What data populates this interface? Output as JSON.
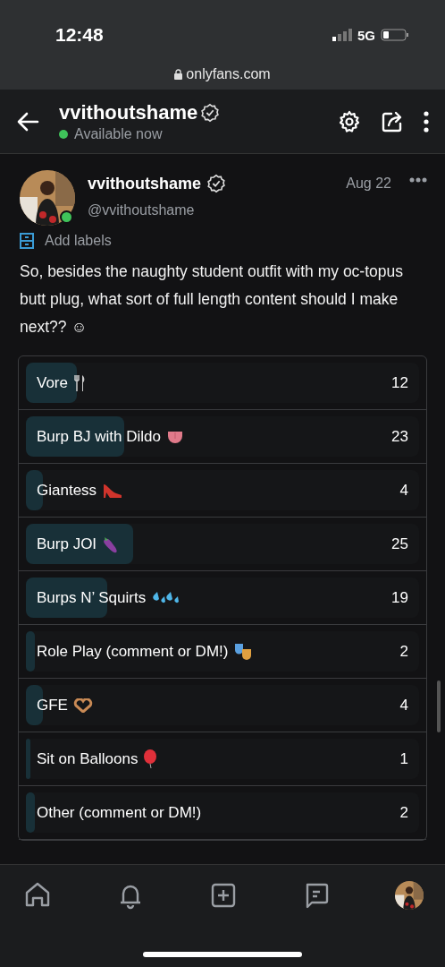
{
  "status_bar": {
    "time": "12:48",
    "network": "5G"
  },
  "browser": {
    "url": "onlyfans.com"
  },
  "header": {
    "title": "vvithoutshame",
    "status": "Available now",
    "online": true
  },
  "post": {
    "author": "vvithoutshame",
    "handle": "@vvithoutshame",
    "date": "Aug 22",
    "online": true,
    "add_labels": "Add labels",
    "text": "So, besides the naughty student outfit with my oc-topus butt plug, what sort of full length content should I make next?? ☺"
  },
  "poll": {
    "options": [
      {
        "label": "Vore",
        "votes": "12",
        "level": 0.13
      },
      {
        "label": "Burp BJ with Dildo",
        "votes": "23",
        "level": 0.25
      },
      {
        "label": "Giantess",
        "votes": "4",
        "level": 0.043
      },
      {
        "label": "Burp JOI",
        "votes": "25",
        "level": 0.272
      },
      {
        "label": "Burps N’ Squirts",
        "votes": "19",
        "level": 0.207
      },
      {
        "label": "Role Play (comment or DM!)",
        "votes": "2",
        "level": 0.022
      },
      {
        "label": "GFE",
        "votes": "4",
        "level": 0.043
      },
      {
        "label": "Sit on Balloons",
        "votes": "1",
        "level": 0.011
      },
      {
        "label": "Other (comment or DM!)",
        "votes": "2",
        "level": 0.022
      }
    ]
  },
  "bottom_nav": [
    {
      "kind": "home",
      "selected": false
    },
    {
      "kind": "bell",
      "selected": false
    },
    {
      "kind": "add",
      "selected": false
    },
    {
      "kind": "chat",
      "selected": false
    },
    {
      "kind": "avatar",
      "selected": false
    }
  ]
}
